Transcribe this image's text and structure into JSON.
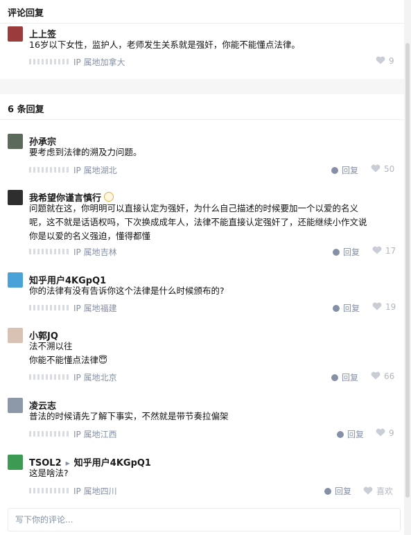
{
  "header": {
    "title": "评论回复"
  },
  "parent_comment": {
    "author": "上上签",
    "text": "16岁以下女性，监护人，老师发生关系就是强奸，你能不能懂点法律。",
    "location": "IP 属地加拿大",
    "likes": "9"
  },
  "replies_header": {
    "title": "6 条回复"
  },
  "reply_label": "回复",
  "replies": [
    {
      "author": "孙承宗",
      "lines": [
        "要考虑到法律的溯及力问题。"
      ],
      "location": "IP 属地湖北",
      "likes": "50"
    },
    {
      "author": "我希望你谨言慎行",
      "lines": [
        "问题就在这，你明明可以直接认定为强奸，为什么自己描述的时候要加一个以爱的名义",
        "呢，这不就是话语权吗，下次换成成年人，法律不能直接认定强奸了，还能继续小作文说",
        "你是以爱的名义强迫，懂得都懂"
      ],
      "location": "IP 属地吉林",
      "likes": "17"
    },
    {
      "author": "知乎用户4KGpQ1",
      "lines": [
        "你的法律有没有告诉你这个法律是什么时候颁布的?"
      ],
      "location": "IP 属地福建",
      "likes": "19"
    },
    {
      "author": "小郭JQ",
      "lines": [
        "法不溯以往",
        "你能不能懂点法律😇"
      ],
      "location": "IP 属地北京",
      "likes": "66"
    },
    {
      "author": "凌云志",
      "lines": [
        "普法的时候请先了解下事实，不然就是带节奏拉偏架"
      ],
      "location": "IP 属地江西",
      "likes": "9"
    },
    {
      "author": "TSOL2",
      "reply_to": "知乎用户4KGpQ1",
      "lines": [
        "这是啥法?"
      ],
      "location": "IP 属地四川",
      "likes": "喜欢"
    }
  ],
  "input": {
    "placeholder": "写下你的评论..."
  }
}
